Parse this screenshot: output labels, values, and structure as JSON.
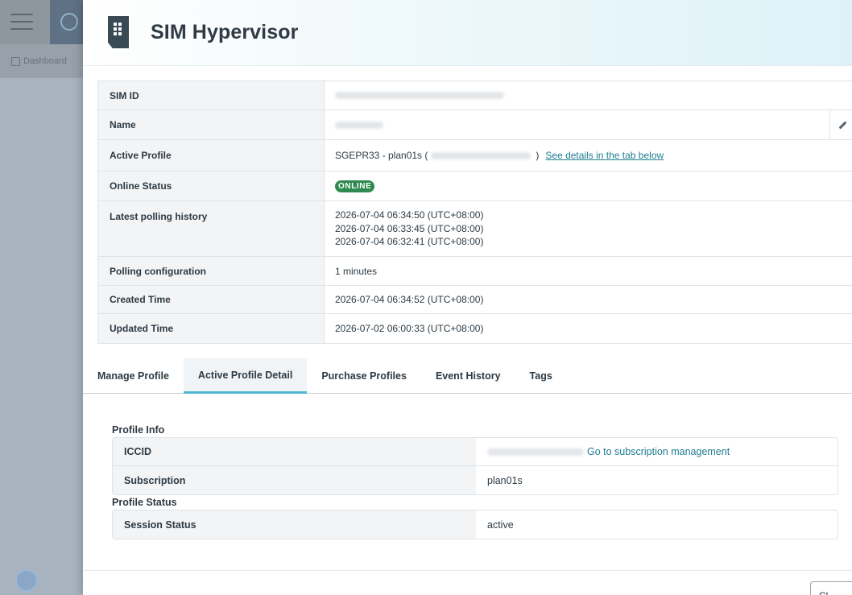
{
  "background": {
    "breadcrumb_label": "Dashboard"
  },
  "drawer": {
    "title": "SIM Hypervisor"
  },
  "details": {
    "sim_id_label": "SIM ID",
    "name_label": "Name",
    "active_profile_label": "Active Profile",
    "active_profile_value": "SGEPR33 - plan01s (",
    "active_profile_close": ")",
    "active_profile_link": "See details in the tab below",
    "online_status_label": "Online Status",
    "online_status_value": "ONLINE",
    "polling_history_label": "Latest polling history",
    "polling_history": [
      "2026-07-04 06:34:50 (UTC+08:00)",
      "2026-07-04 06:33:45 (UTC+08:00)",
      "2026-07-04 06:32:41 (UTC+08:00)"
    ],
    "polling_config_label": "Polling configuration",
    "polling_config_value": "1 minutes",
    "created_time_label": "Created Time",
    "created_time_value": "2026-07-04 06:34:52 (UTC+08:00)",
    "updated_time_label": "Updated Time",
    "updated_time_value": "2026-07-02 06:00:33 (UTC+08:00)"
  },
  "tabs": [
    {
      "label": "Manage Profile",
      "active": false
    },
    {
      "label": "Active Profile Detail",
      "active": true
    },
    {
      "label": "Purchase Profiles",
      "active": false
    },
    {
      "label": "Event History",
      "active": false
    },
    {
      "label": "Tags",
      "active": false
    }
  ],
  "profile_info": {
    "section_title": "Profile Info",
    "iccid_label": "ICCID",
    "iccid_link": "Go to subscription management",
    "subscription_label": "Subscription",
    "subscription_value": "plan01s"
  },
  "profile_status": {
    "section_title": "Profile Status",
    "session_status_label": "Session Status",
    "session_status_value": "active"
  },
  "footer": {
    "close_label": "Cl"
  },
  "colors": {
    "accent": "#4fb8cf",
    "link": "#1f7d91",
    "online_badge": "#2e8a4f"
  }
}
